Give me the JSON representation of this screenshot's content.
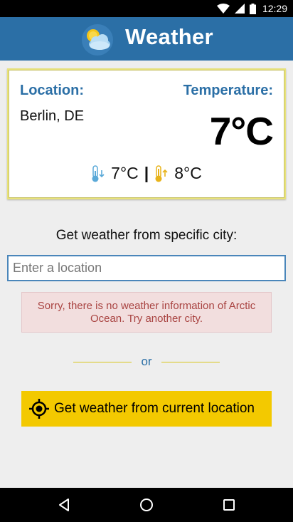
{
  "status_bar": {
    "time": "12:29",
    "icons": [
      "wifi-icon",
      "signal-icon",
      "battery-icon"
    ]
  },
  "toolbar": {
    "title": "Weather",
    "logo_icon": "sun-cloud-icon"
  },
  "weather_card": {
    "location_label": "Location:",
    "location_value": "Berlin, DE",
    "temperature_label": "Temperature:",
    "temperature_value": "7°C",
    "min_temp": "7°C",
    "max_temp": "8°C",
    "separator": "|"
  },
  "city_search": {
    "prompt": "Get weather from specific city:",
    "placeholder": "Enter a location",
    "value": ""
  },
  "error": {
    "message": "Sorry, there is no weather information of Arctic Ocean. Try another city."
  },
  "divider": {
    "text": "or"
  },
  "gps_button": {
    "label": "Get weather from current location",
    "icon": "gps-target-icon"
  },
  "colors": {
    "primary": "#2b6fa6",
    "accent": "#f3c900",
    "error_bg": "#f2dede",
    "error_text": "#a94442"
  }
}
